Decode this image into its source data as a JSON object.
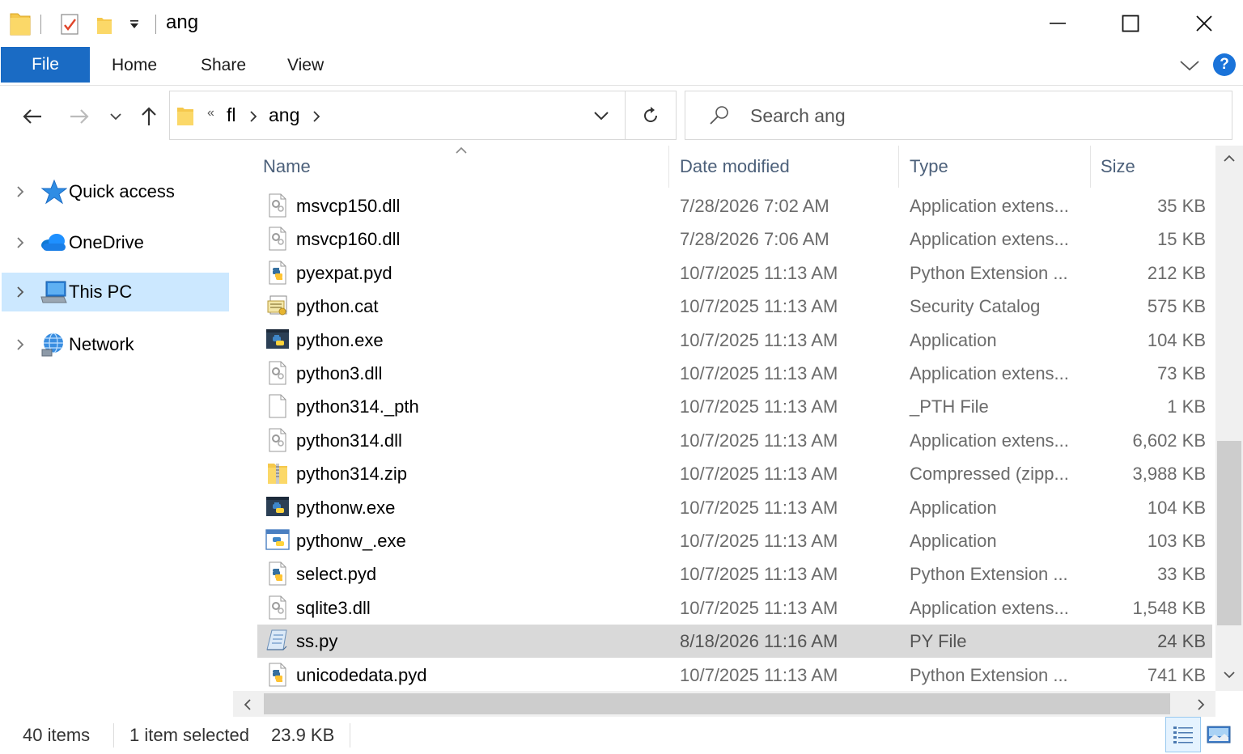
{
  "window": {
    "title": "ang",
    "minimize_icon": "minimize-icon",
    "maximize_icon": "maximize-icon",
    "close_icon": "close-icon"
  },
  "ribbon": {
    "tabs": [
      {
        "label": "File",
        "active": true
      },
      {
        "label": "Home"
      },
      {
        "label": "Share"
      },
      {
        "label": "View"
      }
    ],
    "help_label": "?"
  },
  "address": {
    "overflow": "«",
    "crumbs": [
      "fl",
      "ang"
    ]
  },
  "search": {
    "placeholder": "Search ang"
  },
  "navpane": {
    "items": [
      {
        "label": "Quick access",
        "icon": "star-icon"
      },
      {
        "label": "OneDrive",
        "icon": "cloud-icon"
      },
      {
        "label": "This PC",
        "icon": "computer-icon",
        "selected": true
      },
      {
        "label": "Network",
        "icon": "network-icon"
      }
    ]
  },
  "columns": {
    "name": "Name",
    "date": "Date modified",
    "type": "Type",
    "size": "Size"
  },
  "files": [
    {
      "name": "msvcp150.dll",
      "date": "7/28/2026 7:02 AM",
      "type": "Application extens...",
      "size": "35 KB",
      "icon": "dll-icon"
    },
    {
      "name": "msvcp160.dll",
      "date": "7/28/2026 7:06 AM",
      "type": "Application extens...",
      "size": "15 KB",
      "icon": "dll-icon"
    },
    {
      "name": "pyexpat.pyd",
      "date": "10/7/2025 11:13 AM",
      "type": "Python Extension ...",
      "size": "212 KB",
      "icon": "python-file-icon"
    },
    {
      "name": "python.cat",
      "date": "10/7/2025 11:13 AM",
      "type": "Security Catalog",
      "size": "575 KB",
      "icon": "catalog-icon"
    },
    {
      "name": "python.exe",
      "date": "10/7/2025 11:13 AM",
      "type": "Application",
      "size": "104 KB",
      "icon": "python-exe-icon"
    },
    {
      "name": "python3.dll",
      "date": "10/7/2025 11:13 AM",
      "type": "Application extens...",
      "size": "73 KB",
      "icon": "dll-icon"
    },
    {
      "name": "python314._pth",
      "date": "10/7/2025 11:13 AM",
      "type": "_PTH File",
      "size": "1 KB",
      "icon": "blank-file-icon"
    },
    {
      "name": "python314.dll",
      "date": "10/7/2025 11:13 AM",
      "type": "Application extens...",
      "size": "6,602 KB",
      "icon": "dll-icon"
    },
    {
      "name": "python314.zip",
      "date": "10/7/2025 11:13 AM",
      "type": "Compressed (zipp...",
      "size": "3,988 KB",
      "icon": "zip-folder-icon"
    },
    {
      "name": "pythonw.exe",
      "date": "10/7/2025 11:13 AM",
      "type": "Application",
      "size": "104 KB",
      "icon": "python-exe-icon"
    },
    {
      "name": "pythonw_.exe",
      "date": "10/7/2025 11:13 AM",
      "type": "Application",
      "size": "103 KB",
      "icon": "python-window-icon"
    },
    {
      "name": "select.pyd",
      "date": "10/7/2025 11:13 AM",
      "type": "Python Extension ...",
      "size": "33 KB",
      "icon": "python-file-icon"
    },
    {
      "name": "sqlite3.dll",
      "date": "10/7/2025 11:13 AM",
      "type": "Application extens...",
      "size": "1,548 KB",
      "icon": "dll-icon"
    },
    {
      "name": "ss.py",
      "date": "8/18/2026 11:16 AM",
      "type": "PY File",
      "size": "24 KB",
      "icon": "script-file-icon",
      "selected": true
    },
    {
      "name": "unicodedata.pyd",
      "date": "10/7/2025 11:13 AM",
      "type": "Python Extension ...",
      "size": "741 KB",
      "icon": "python-file-icon"
    }
  ],
  "status": {
    "count": "40 items",
    "selection": "1 item selected",
    "selection_size": "23.9 KB"
  },
  "colors": {
    "accent": "#1a6bc4",
    "selection_nav": "#cce8ff",
    "selection_row": "#d9d9d9",
    "column_header": "#4c607a"
  }
}
